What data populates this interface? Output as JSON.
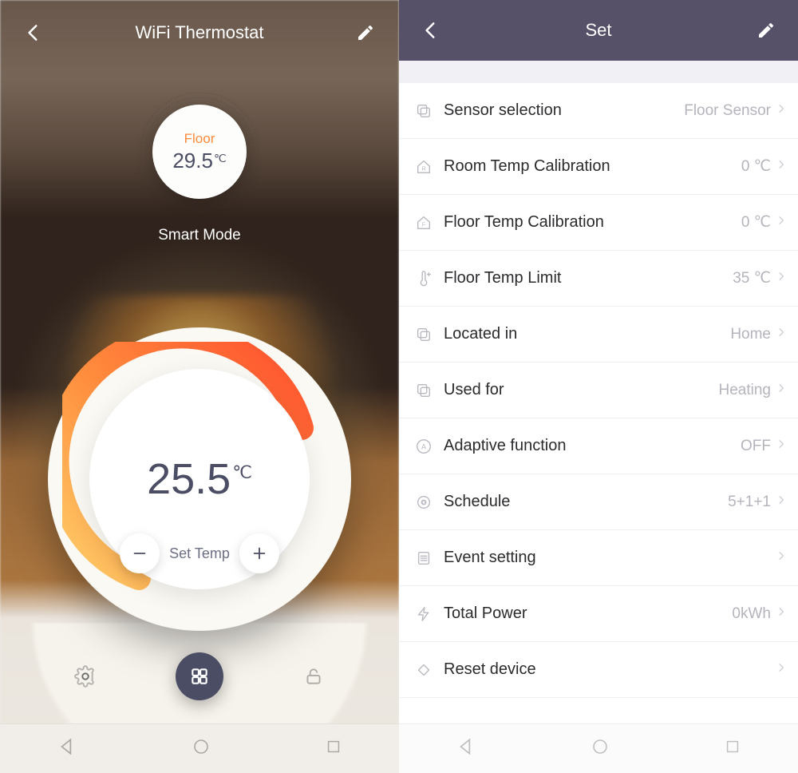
{
  "left": {
    "title": "WiFi Thermostat",
    "sensor_label": "Floor",
    "sensor_temp": "29.5",
    "sensor_unit": "℃",
    "mode": "Smart Mode",
    "set_temp": "25.5",
    "set_temp_unit": "℃",
    "set_label": "Set Temp"
  },
  "right": {
    "title": "Set",
    "rows": [
      {
        "icon": "copy",
        "label": "Sensor selection",
        "value": "Floor Sensor"
      },
      {
        "icon": "house-r",
        "label": "Room Temp Calibration",
        "value": "0 ℃"
      },
      {
        "icon": "house-f",
        "label": "Floor Temp Calibration",
        "value": "0 ℃"
      },
      {
        "icon": "therm",
        "label": "Floor Temp Limit",
        "value": "35 ℃"
      },
      {
        "icon": "copy",
        "label": "Located in",
        "value": "Home"
      },
      {
        "icon": "copy",
        "label": "Used for",
        "value": "Heating"
      },
      {
        "icon": "circle-a",
        "label": "Adaptive function",
        "value": "OFF"
      },
      {
        "icon": "gear-p",
        "label": "Schedule",
        "value": "5+1+1"
      },
      {
        "icon": "list",
        "label": "Event setting",
        "value": ""
      },
      {
        "icon": "bolt",
        "label": "Total Power",
        "value": "0kWh"
      },
      {
        "icon": "diamond",
        "label": "Reset device",
        "value": ""
      }
    ]
  }
}
